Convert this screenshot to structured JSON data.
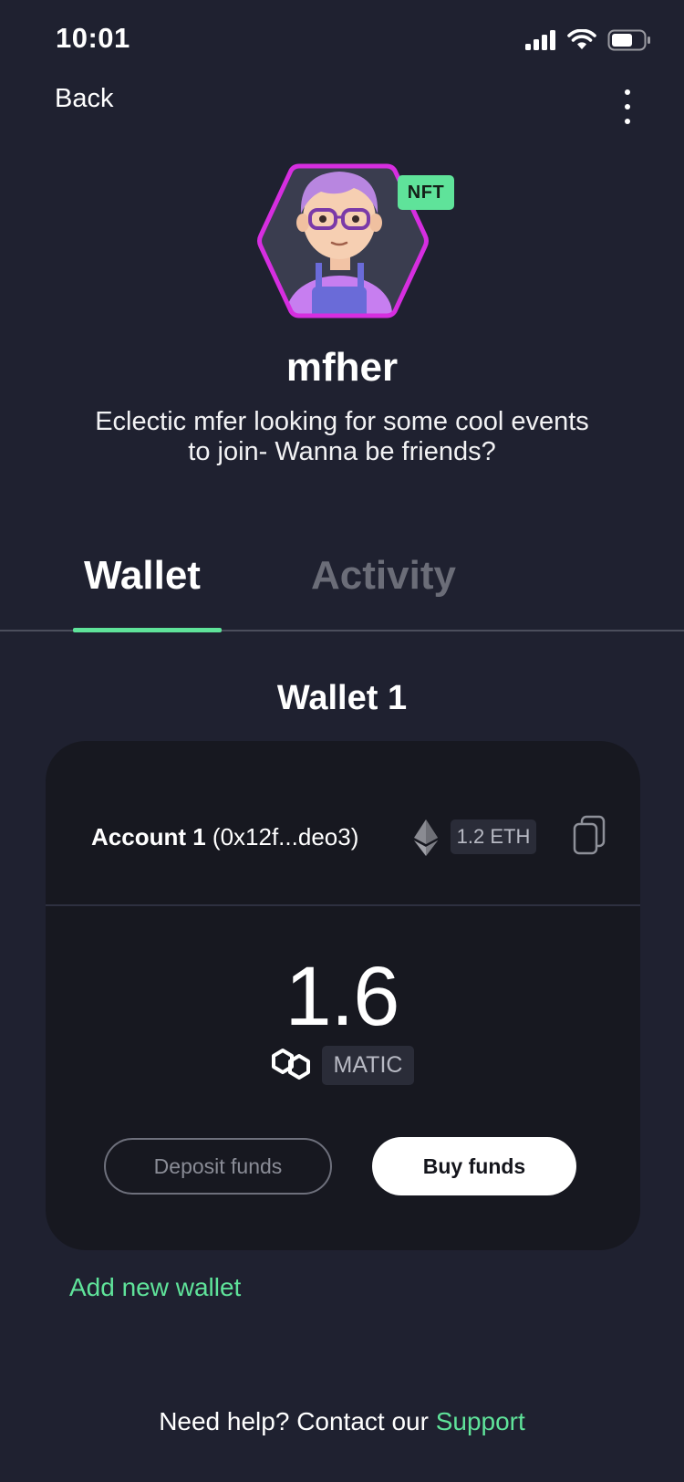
{
  "status_bar": {
    "time": "10:01"
  },
  "nav": {
    "back_label": "Back"
  },
  "profile": {
    "badge": "NFT",
    "username": "mfher",
    "bio": "Eclectic mfer looking for some cool events to join- Wanna be friends?"
  },
  "tabs": [
    {
      "label": "Wallet",
      "active": true
    },
    {
      "label": "Activity",
      "active": false
    }
  ],
  "wallet": {
    "title": "Wallet 1",
    "account": {
      "name": "Account 1",
      "address": "(0x12f...deo3)",
      "eth_badge": "1.2 ETH"
    },
    "balance": "1.6",
    "currency": "MATIC",
    "deposit_label": "Deposit funds",
    "buy_label": "Buy funds",
    "add_wallet_label": "Add new wallet"
  },
  "footer": {
    "help_text": "Need help? Contact our ",
    "support_link": "Support"
  },
  "colors": {
    "background": "#1f2130",
    "card": "#171820",
    "accent": "#5fe39a",
    "avatar_border": "#d62ee0"
  },
  "icons": [
    "signal-icon",
    "wifi-icon",
    "battery-icon",
    "more-vertical-icon",
    "ethereum-icon",
    "copy-icon",
    "polygon-matic-icon"
  ]
}
